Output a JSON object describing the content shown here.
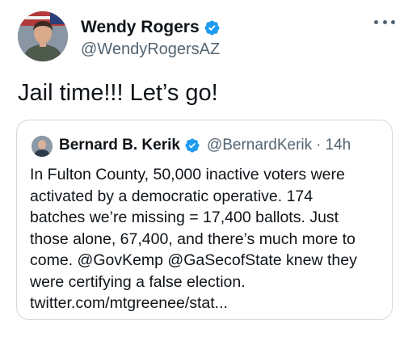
{
  "tweet": {
    "author_name": "Wendy Rogers",
    "author_handle": "@WendyRogersAZ",
    "text": "Jail time!!! Let’s go!"
  },
  "quoted_tweet": {
    "author_name": "Bernard B. Kerik",
    "author_handle": "@BernardKerik",
    "separator": "·",
    "time": "14h",
    "lines": [
      "In Fulton County, 50,000 inactive voters were",
      "activated by a democratic operative. 174",
      "batches we’re missing = 17,400 ballots. Just",
      "those alone, 67,400, and there’s much more to",
      "come.  @GovKemp @GaSecofState knew they",
      "were certifying a false election.",
      "twitter.com/mtgreenee/stat..."
    ]
  },
  "icons": {
    "verified": "verified-badge-icon",
    "more": "more-options-icon"
  },
  "colors": {
    "verified_blue": "#1d9bf0",
    "text_primary": "#0f1419",
    "text_secondary": "#536471",
    "border": "#cfd9de"
  }
}
